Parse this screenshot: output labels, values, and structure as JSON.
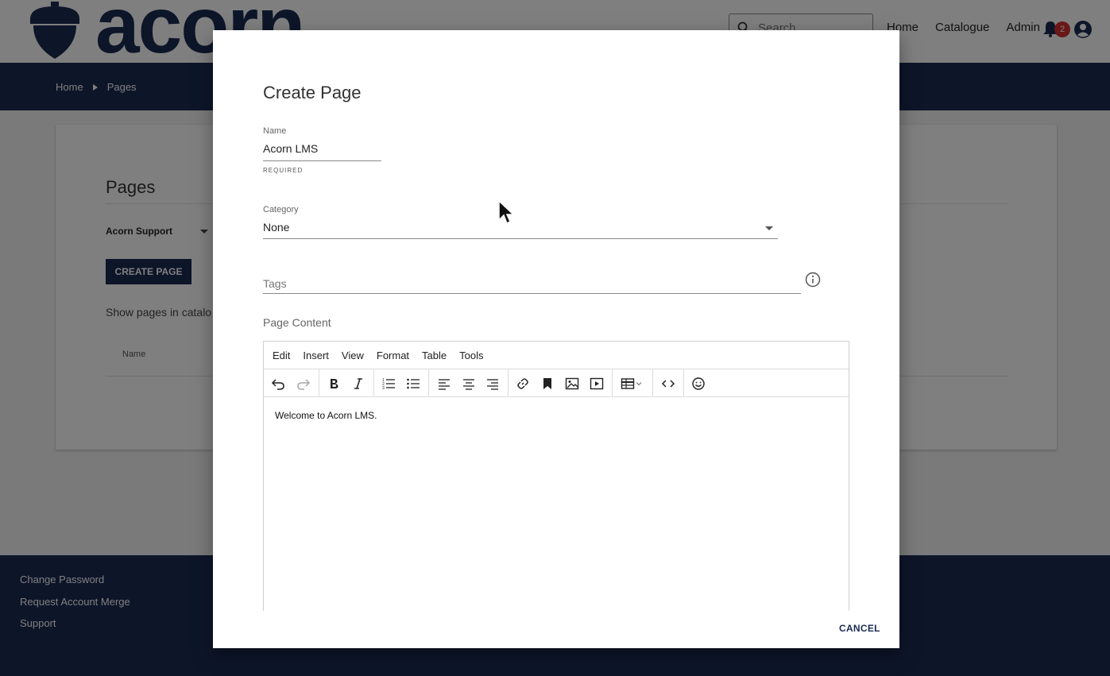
{
  "header": {
    "logo_text": "acorn",
    "search_placeholder": "Search",
    "nav": [
      "Home",
      "Catalogue",
      "Admin"
    ],
    "notification_count": "2"
  },
  "breadcrumb": [
    "Home",
    "Pages"
  ],
  "card": {
    "title": "Pages",
    "catalogue": "Acorn Support",
    "create_button": "CREATE PAGE",
    "show_text": "Show pages in catalo",
    "column_name": "Name"
  },
  "footer": {
    "links": [
      "Change Password",
      "Request Account Merge",
      "Support"
    ]
  },
  "modal": {
    "title": "Create Page",
    "name_label": "Name",
    "name_value": "Acorn LMS",
    "name_hint": "REQUIRED",
    "category_label": "Category",
    "category_value": "None",
    "tags_placeholder": "Tags",
    "content_label": "Page Content",
    "editor_menu": [
      "Edit",
      "Insert",
      "View",
      "Format",
      "Table",
      "Tools"
    ],
    "editor_toolbar": [
      "undo-icon",
      "redo-icon",
      "bold-icon",
      "italic-icon",
      "numbered-list-icon",
      "bullet-list-icon",
      "align-left-icon",
      "align-center-icon",
      "align-right-icon",
      "link-icon",
      "bookmark-icon",
      "image-icon",
      "media-icon",
      "table-icon",
      "code-icon",
      "emoji-icon"
    ],
    "editor_content": "Welcome to Acorn LMS.",
    "cancel_button": "CANCEL"
  },
  "colors": {
    "brand_navy": "#1a2a52",
    "badge_red": "#d32f2f"
  }
}
